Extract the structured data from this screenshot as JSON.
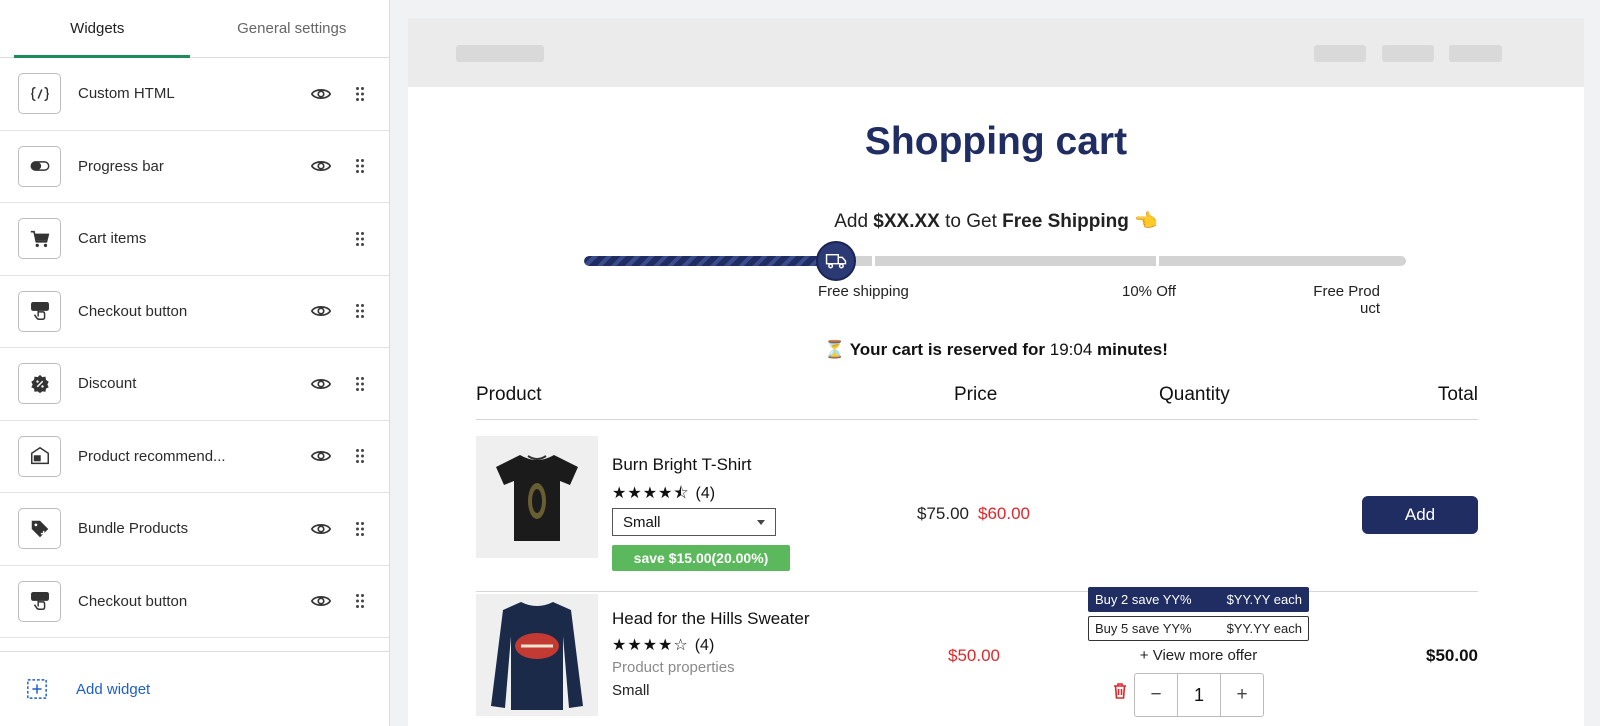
{
  "sidebar": {
    "tabs": [
      {
        "label": "Widgets",
        "active": true
      },
      {
        "label": "General settings",
        "active": false
      }
    ],
    "widgets": [
      {
        "label": "Custom HTML",
        "icon": "code-icon",
        "visible_toggle": true
      },
      {
        "label": "Progress bar",
        "icon": "toggle-icon",
        "visible_toggle": true
      },
      {
        "label": "Cart items",
        "icon": "cart-icon",
        "visible_toggle": false
      },
      {
        "label": "Checkout button",
        "icon": "checkout-icon",
        "visible_toggle": true
      },
      {
        "label": "Discount",
        "icon": "discount-badge-icon",
        "visible_toggle": true
      },
      {
        "label": "Product recommend...",
        "icon": "recommend-icon",
        "visible_toggle": true
      },
      {
        "label": "Bundle Products",
        "icon": "tag-plus-icon",
        "visible_toggle": true
      },
      {
        "label": "Checkout button",
        "icon": "checkout-icon",
        "visible_toggle": true
      }
    ],
    "add_widget_label": "Add widget"
  },
  "cart": {
    "title": "Shopping cart",
    "shipping_message": {
      "prefix": "Add ",
      "amount": "$XX.XX",
      "middle": " to Get ",
      "goal": "Free Shipping",
      "emoji": "👈"
    },
    "progress": {
      "value": 0.3,
      "milestones": [
        {
          "label": "Free shipping",
          "position": 0.3
        },
        {
          "label": "10% Off",
          "position": 0.71
        },
        {
          "label": "Free Prod uct",
          "position": 1.0
        }
      ]
    },
    "reserved": {
      "emoji": "⏳",
      "prefix": "Your cart is reserved for",
      "time": "19:04",
      "suffix": "minutes!"
    },
    "columns": {
      "product": "Product",
      "price": "Price",
      "quantity": "Quantity",
      "total": "Total"
    },
    "items": [
      {
        "name": "Burn Bright T-Shirt",
        "rating": 4.5,
        "rating_stars": "★★★★⯪",
        "rating_count": "(4)",
        "variant_select": "Small",
        "save_badge": "save $15.00(20.00%)",
        "price_old": "$75.00",
        "price_new": "$60.00",
        "action": "Add"
      },
      {
        "name": "Head for the Hills Sweater",
        "rating": 4,
        "rating_stars": "★★★★☆",
        "rating_count": "(4)",
        "properties_label": "Product properties",
        "variant": "Small",
        "price_new": "$50.00",
        "offers": [
          {
            "label": "Buy 2 save YY%",
            "price": "$YY.YY each",
            "selected": true
          },
          {
            "label": "Buy 5 save YY%",
            "price": "$YY.YY each",
            "selected": false
          }
        ],
        "view_more": "+ View more offer",
        "quantity": "1",
        "total": "$50.00"
      }
    ]
  },
  "colors": {
    "brand": "#1f2d63",
    "sale": "#e0262b",
    "save_badge": "#5cb85c",
    "tab_underline": "#1c8d5a",
    "link": "#1e5ec9"
  }
}
